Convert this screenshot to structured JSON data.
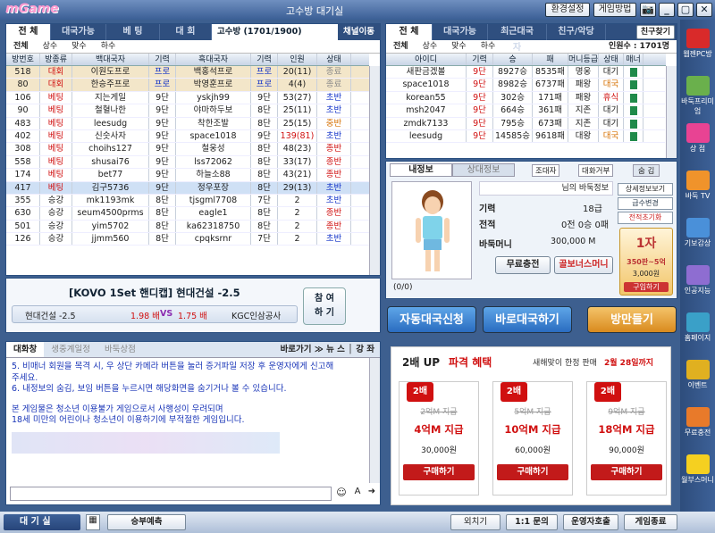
{
  "app": {
    "logo": "mGame",
    "title": "고수방 대기실",
    "btn_settings": "환경설정",
    "btn_help": "게임방법",
    "btn_icons": [
      "📷",
      "_",
      "▢",
      "✕"
    ]
  },
  "left": {
    "tabs": [
      "전 체",
      "대국가능",
      "베 팅",
      "대 회"
    ],
    "room_info": "고수방 (1701/1900)",
    "channel_btn": "채널이동",
    "filters": [
      "전체",
      "상수",
      "맞수",
      "하수"
    ],
    "columns": [
      "방번호",
      "방종류",
      "백대국자",
      "기력",
      "흑대국자",
      "기력",
      "인원",
      "상태"
    ],
    "rows": [
      [
        "518",
        "대회",
        "이원도프로",
        "프로",
        "백홍석프로",
        "프로",
        "20(11)",
        "종료"
      ],
      [
        "80",
        "대회",
        "한승주프로",
        "프로",
        "박영훈프로",
        "프로",
        "4(4)",
        "종료"
      ],
      [
        "106",
        "베팅",
        "지는게일",
        "9단",
        "yskjh99",
        "9단",
        "53(27)",
        "초반"
      ],
      [
        "90",
        "베팅",
        "철혈나한",
        "9단",
        "야마하두보",
        "8단",
        "25(11)",
        "초반"
      ],
      [
        "483",
        "베팅",
        "leesudg",
        "9단",
        "착한조발",
        "8단",
        "25(15)",
        "중반"
      ],
      [
        "402",
        "베팅",
        "신숫사자",
        "9단",
        "space1018",
        "9단",
        "139(81)",
        "초반"
      ],
      [
        "308",
        "베팅",
        "choihs127",
        "9단",
        "철웅성",
        "8단",
        "48(23)",
        "종반"
      ],
      [
        "558",
        "베팅",
        "shusai76",
        "9단",
        "lss72062",
        "8단",
        "33(17)",
        "종반"
      ],
      [
        "174",
        "베팅",
        "bet77",
        "9단",
        "하늘소88",
        "8단",
        "43(21)",
        "종반"
      ],
      [
        "417",
        "베팅",
        "김구5736",
        "9단",
        "정우포장",
        "8단",
        "29(13)",
        "초반"
      ],
      [
        "355",
        "승강",
        "mk1193mk",
        "8단",
        "tjsgml7708",
        "7단",
        "2",
        "초반"
      ],
      [
        "630",
        "승강",
        "seum4500prms",
        "8단",
        "eagle1",
        "8단",
        "2",
        "종반"
      ],
      [
        "501",
        "승강",
        "yim5702",
        "8단",
        "ka62318750",
        "8단",
        "2",
        "종반"
      ],
      [
        "126",
        "승강",
        "jjmm560",
        "8단",
        "cpqksrnr",
        "7단",
        "2",
        "초반"
      ]
    ],
    "banner": {
      "title": "[KOVO 1Set 핸디캡] 현대건설 -2.5",
      "team1": "현대건설 -2.5",
      "odds1": "1.98 배",
      "vs": "VS",
      "odds2": "1.75 배",
      "team2": "KGC인삼공사",
      "join": "참 여\n하 기"
    }
  },
  "chat": {
    "tabs": [
      "대화창",
      "생중계일정",
      "바둑상점"
    ],
    "links": "바로가기 ≫ 뉴 스 │ 강 좌",
    "lines": [
      "5. 비매너 회원을 목격 시, 우 상단 카메라 버튼을 눌러 증거파일 저장 후 운영자에게 신고해",
      "주세요.",
      "6. 내정보의 숨김, 보임 버튼을 누르시면 해당화면을 숨기거나 볼 수 있습니다.",
      "",
      "본 게임물은 청소년 이용불가 게임으로서 사행성이 우려되며",
      "18세 미만의 어린이나 청소년이 이용하기에 부적절한 게임입니다."
    ],
    "input_placeholder": ""
  },
  "right": {
    "tabs": [
      "전 체",
      "대국가능",
      "최근대국자",
      "친구/악당"
    ],
    "friend_btn": "친구찾기",
    "filters": [
      "전체",
      "상수",
      "맞수",
      "하수"
    ],
    "users_count": "인원수 : 1701명",
    "columns": [
      "아이디",
      "기력",
      "승",
      "패",
      "머니등급",
      "상태",
      "매너"
    ],
    "rows": [
      [
        "새판금겠볼",
        "9단",
        "8927승",
        "8535패",
        "명웅",
        "대기"
      ],
      [
        "space1018",
        "9단",
        "8982승",
        "6737패",
        "패왕",
        "대국"
      ],
      [
        "korean55",
        "9단",
        "302승",
        "171패",
        "패왕",
        "휴식"
      ],
      [
        "msh2047",
        "9단",
        "664승",
        "361패",
        "지존",
        "대기"
      ],
      [
        "zmdk7133",
        "9단",
        "795승",
        "673패",
        "지존",
        "대기"
      ],
      [
        "leesudg",
        "9단",
        "14585승",
        "9618패",
        "대왕",
        "대국"
      ]
    ],
    "info_tabs": [
      "내정보",
      "상대정보"
    ],
    "info_small": [
      "조대자",
      "대화거부"
    ],
    "hide_btn": "숨 김",
    "profile_name": "님의 바둑정보",
    "detail_btn": "상세정보보기",
    "grade_btn": "급수변경",
    "record_btn": "전적초기화",
    "level_label": "기력",
    "level_value": "18급",
    "record_label": "전적",
    "record_value": "0전 0승 0패",
    "money_label": "바둑머니",
    "money_value": "300,000 M",
    "charge_btn": "무료충전",
    "bonus_btn": "골보너스머니",
    "promo": {
      "badge": "1자",
      "price": "350판~5억",
      "amount": "3,000원",
      "buy": "구입하기"
    },
    "stat": "(0/0)"
  },
  "actions": {
    "auto": "자동대국신청",
    "quick": "바로대국하기",
    "make": "방만들기"
  },
  "ad": {
    "title": "2배 UP",
    "title2": "파격 혜택",
    "sub": "새해맞이 한정 판매",
    "date": "2월 28일까지",
    "coupons": [
      {
        "badge": "2배",
        "old": "2억M 지급",
        "new": "4억M 지급",
        "price": "30,000원",
        "buy": "구매하기"
      },
      {
        "badge": "2배",
        "old": "5억M 지급",
        "new": "10억M 지급",
        "price": "60,000원",
        "buy": "구매하기"
      },
      {
        "badge": "2배",
        "old": "9억M 지급",
        "new": "18억M 지급",
        "price": "90,000원",
        "buy": "구매하기"
      }
    ]
  },
  "sidebar": [
    "웹젠PC방",
    "바둑프리미엄",
    "상 점",
    "바둑 TV",
    "기보감상",
    "인공지능",
    "홈페이지",
    "이벤트",
    "무료충전",
    "월부스머니"
  ],
  "bottom": {
    "lobby": "대 기 실",
    "predict": "승부예측",
    "exit": "외치기",
    "inquiry": "1:1 문의",
    "operator": "운영자호출",
    "quit": "게임종료"
  }
}
